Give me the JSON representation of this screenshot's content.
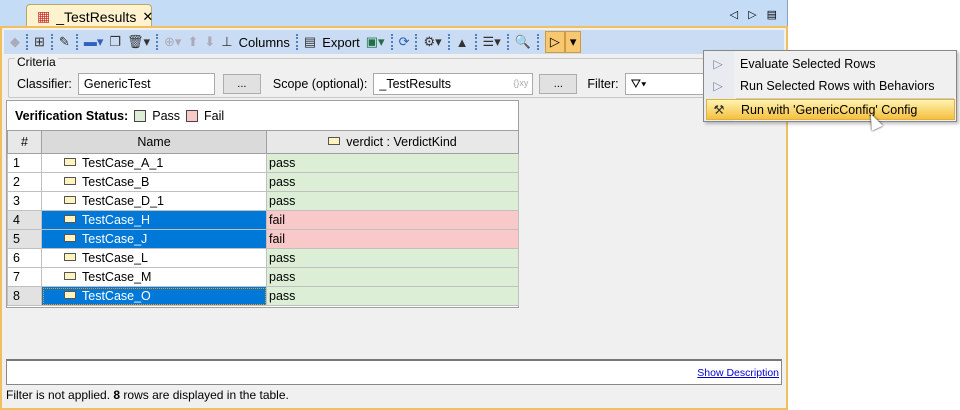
{
  "tab": {
    "title": "_TestResults",
    "icon": "table-icon"
  },
  "toolbar": {
    "columns_label": "Columns",
    "export_label": "Export"
  },
  "criteria": {
    "legend": "Criteria",
    "classifier_label": "Classifier:",
    "classifier_value": "GenericTest",
    "browse_label": "...",
    "scope_label": "Scope (optional):",
    "scope_value": "_TestResults",
    "scope_hint": "{}xy",
    "filter_label": "Filter:"
  },
  "legend": {
    "title": "Verification Status:",
    "pass": "Pass",
    "fail": "Fail",
    "pass_color": "#dcefd6",
    "fail_color": "#f9c8c8"
  },
  "table": {
    "headers": [
      "#",
      "Name",
      "verdict : VerdictKind"
    ],
    "rows": [
      {
        "num": "1",
        "name": "TestCase_A_1",
        "verdict": "pass",
        "selected": false
      },
      {
        "num": "2",
        "name": "TestCase_B",
        "verdict": "pass",
        "selected": false
      },
      {
        "num": "3",
        "name": "TestCase_D_1",
        "verdict": "pass",
        "selected": false
      },
      {
        "num": "4",
        "name": "TestCase_H",
        "verdict": "fail",
        "selected": true
      },
      {
        "num": "5",
        "name": "TestCase_J",
        "verdict": "fail",
        "selected": true
      },
      {
        "num": "6",
        "name": "TestCase_L",
        "verdict": "pass",
        "selected": false
      },
      {
        "num": "7",
        "name": "TestCase_M",
        "verdict": "pass",
        "selected": false
      },
      {
        "num": "8",
        "name": "TestCase_O",
        "verdict": "pass",
        "selected": true
      }
    ]
  },
  "description_link": "Show Description",
  "status": {
    "prefix": "Filter is not applied. ",
    "count": "8",
    "suffix": " rows are displayed in the table."
  },
  "menu": {
    "items": [
      "Evaluate Selected Rows",
      "Run Selected Rows with Behaviors",
      "Run with 'GenericConfig' Config"
    ]
  }
}
